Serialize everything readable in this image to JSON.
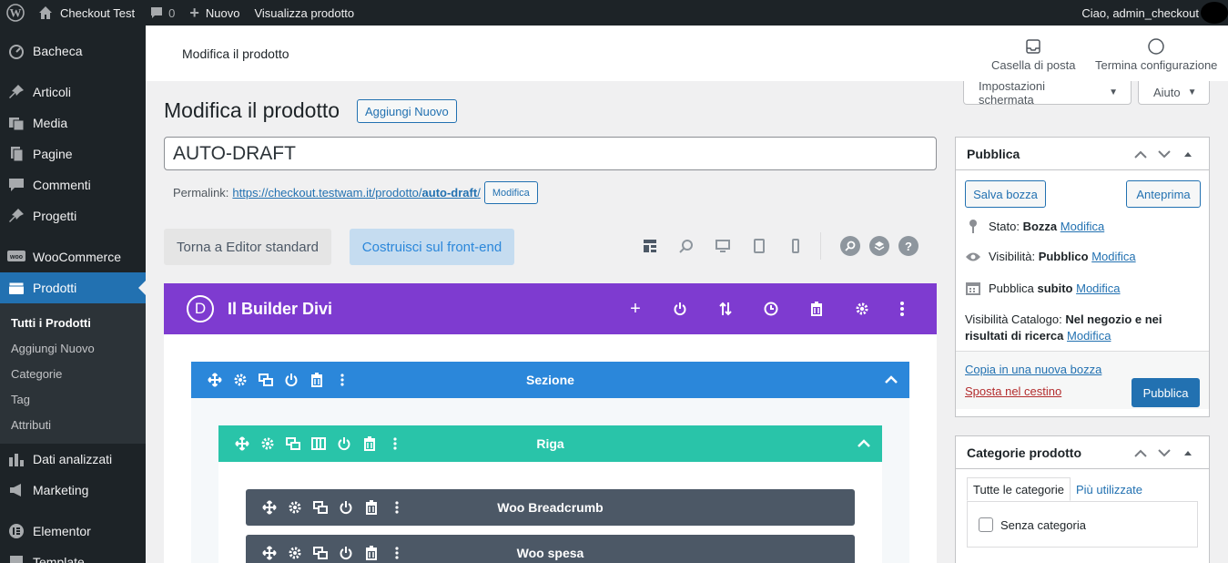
{
  "admin_bar": {
    "site_name": "Checkout Test",
    "comments_count": "0",
    "new_label": "Nuovo",
    "view_product": "Visualizza prodotto",
    "greeting": "Ciao, admin_checkout"
  },
  "sidebar": {
    "items": [
      {
        "label": "Bacheca",
        "icon": "dashboard-icon"
      },
      {
        "label": "Articoli",
        "icon": "pin-icon"
      },
      {
        "label": "Media",
        "icon": "media-icon"
      },
      {
        "label": "Pagine",
        "icon": "page-icon"
      },
      {
        "label": "Commenti",
        "icon": "comment-icon"
      },
      {
        "label": "Progetti",
        "icon": "pin-icon"
      },
      {
        "label": "WooCommerce",
        "icon": "woo-icon"
      },
      {
        "label": "Prodotti",
        "icon": "products-icon"
      },
      {
        "label": "Dati analizzati",
        "icon": "chart-icon"
      },
      {
        "label": "Marketing",
        "icon": "megaphone-icon"
      },
      {
        "label": "Elementor",
        "icon": "elementor-icon"
      },
      {
        "label": "Template",
        "icon": "template-icon"
      }
    ],
    "submenu": [
      "Tutti i Prodotti",
      "Aggiungi Nuovo",
      "Categorie",
      "Tag",
      "Attributi"
    ]
  },
  "header": {
    "title": "Modifica il prodotto",
    "inbox_label": "Casella di posta",
    "finish_setup_label": "Termina configurazione",
    "screen_options": "Impostazioni schermata",
    "help": "Aiuto"
  },
  "editor": {
    "heading": "Modifica il prodotto",
    "add_new": "Aggiungi Nuovo",
    "title_value": "AUTO-DRAFT",
    "permalink_label": "Permalink:",
    "permalink_base": "https://checkout.testwam.it/prodotto/",
    "permalink_slug": "auto-draft",
    "permalink_trailing": "/",
    "permalink_edit": "Modifica",
    "btn_standard": "Torna a Editor standard",
    "btn_frontend": "Costruisci sul front-end"
  },
  "divi": {
    "logo_letter": "D",
    "title": "Il Builder Divi",
    "section_label": "Sezione",
    "row_label": "Riga",
    "modules": [
      "Woo Breadcrumb",
      "Woo spesa"
    ],
    "colors": {
      "header": "#7e3bd0",
      "section": "#2b87da",
      "row": "#29c4a9",
      "module": "#4c5866"
    }
  },
  "publish_box": {
    "title": "Pubblica",
    "save_draft": "Salva bozza",
    "preview": "Anteprima",
    "status_label": "Stato:",
    "status_value": "Bozza",
    "visibility_label": "Visibilità:",
    "visibility_value": "Pubblico",
    "publish_label": "Pubblica",
    "publish_value": "subito",
    "catalog_label": "Visibilità Catalogo:",
    "catalog_value": "Nel negozio e nei risultati di ricerca",
    "edit_link": "Modifica",
    "copy_draft": "Copia in una nuova bozza",
    "trash": "Sposta nel cestino",
    "publish_button": "Pubblica"
  },
  "categories_box": {
    "title": "Categorie prodotto",
    "tab_all": "Tutte le categorie",
    "tab_most_used": "Più utilizzate",
    "category": "Senza categoria"
  }
}
